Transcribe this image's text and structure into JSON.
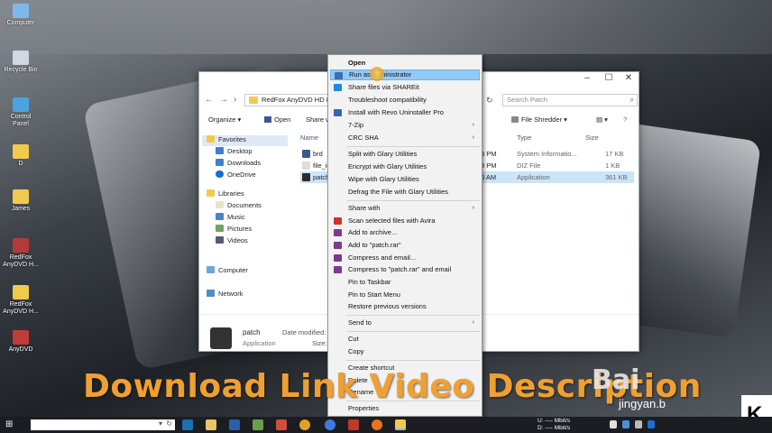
{
  "desktop_icons": [
    {
      "label": "Computer",
      "color": "#7fb8e8"
    },
    {
      "label": "Recycle Bin",
      "color": "#cfd8e3"
    },
    {
      "label": "Control Panel",
      "color": "#4aa3df"
    },
    {
      "label": "D",
      "color": "#f3c94d"
    },
    {
      "label": "James",
      "color": "#f3c94d"
    },
    {
      "label": "RedFox AnyDVD H...",
      "color": "#b33a3a"
    },
    {
      "label": "RedFox AnyDVD H...",
      "color": "#f3c94d"
    },
    {
      "label": "AnyDVD",
      "color": "#c23b3b"
    }
  ],
  "explorer": {
    "address": "RedFox AnyDVD HD 8...",
    "search_placeholder": "Search Patch",
    "toolbar": {
      "organize": "Organize ▾",
      "open": "Open",
      "share": "Share w",
      "file_shredder": "File Shredder ▾"
    },
    "nav": {
      "favorites": "Favorites",
      "desktop": "Desktop",
      "downloads": "Downloads",
      "onedrive": "OneDrive",
      "libraries": "Libraries",
      "documents": "Documents",
      "music": "Music",
      "pictures": "Pictures",
      "videos": "Videos",
      "computer": "Computer",
      "network": "Network"
    },
    "columns": {
      "name": "Name",
      "type": "Type",
      "size": "Size"
    },
    "files": [
      {
        "name": "brd",
        "date": "3 PM",
        "type": "System Informatio...",
        "size": "17 KB"
      },
      {
        "name": "file_id",
        "date": "3 PM",
        "type": "DIZ File",
        "size": "1 KB"
      },
      {
        "name": "patch",
        "date": "0 AM",
        "type": "Application",
        "size": "361 KB"
      }
    ],
    "details": {
      "name": "patch",
      "type": "Application",
      "modified_label": "Date modified: 1",
      "size_label": "Size:"
    }
  },
  "context_menu": {
    "open": "Open",
    "run_admin": "Run as administrator",
    "share_shareit": "Share files via SHAREit",
    "troubleshoot": "Troubleshoot compatibility",
    "revo": "Install with Revo Uninstaller Pro",
    "zip": "7-Zip",
    "crc": "CRC SHA",
    "split": "Split with Glary Utilities",
    "encrypt": "Encrypt with Glary Utilities",
    "wipe": "Wipe with Glary Utilities",
    "defrag": "Defrag the File with Glary Utilities",
    "share_with": "Share with",
    "avira": "Scan selected files with Avira",
    "add_archive": "Add to archive...",
    "add_rar": "Add to \"patch.rar\"",
    "compress_email": "Compress and email...",
    "compress_rar_email": "Compress to \"patch.rar\" and email",
    "pin_taskbar": "Pin to Taskbar",
    "pin_start": "Pin to Start Menu",
    "restore": "Restore previous versions",
    "send_to": "Send to",
    "cut": "Cut",
    "copy": "Copy",
    "create_shortcut": "Create shortcut",
    "delete": "Delete",
    "rename": "Rename",
    "properties": "Properties"
  },
  "overlay": {
    "banner": "Download Link Video Description",
    "baidu": "Bai",
    "jingyan": "jingyan.b",
    "corner": "K"
  },
  "taskbar": {
    "tray_line1": "U:       ---- Mbit/s",
    "tray_line2": "D:       ---- Mbit/s"
  }
}
